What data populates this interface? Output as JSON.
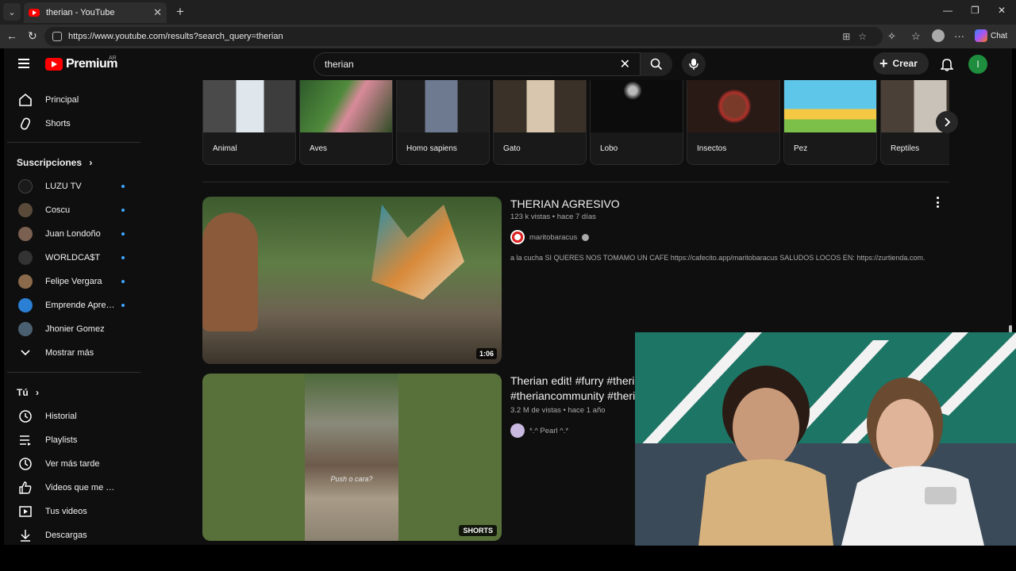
{
  "browser": {
    "tab_title": "therian - YouTube",
    "url": "https://www.youtube.com/results?search_query=therian",
    "copilot_label": "Chat"
  },
  "youtube": {
    "logo_text": "Premium",
    "country_code": "AR",
    "search_query": "therian",
    "create_label": "Crear",
    "user_initial": "I"
  },
  "sidebar": {
    "main": [
      {
        "label": "Principal",
        "icon": "home-icon"
      },
      {
        "label": "Shorts",
        "icon": "shorts-icon"
      }
    ],
    "subscriptions_title": "Suscripciones",
    "subscriptions": [
      {
        "label": "LUZU TV",
        "color": "#1a1a1a"
      },
      {
        "label": "Coscu",
        "color": "#5a4a3a"
      },
      {
        "label": "Juan Londoño",
        "color": "#7a6050"
      },
      {
        "label": "WORLDCA$T",
        "color": "#333333"
      },
      {
        "label": "Felipe Vergara",
        "color": "#8a6a4a"
      },
      {
        "label": "Emprende Apren...",
        "color": "#2b7fd4"
      },
      {
        "label": "Jhonier Gomez",
        "color": "#4a6070"
      }
    ],
    "show_more": "Mostrar más",
    "you_title": "Tú",
    "you_items": [
      {
        "label": "Historial",
        "icon": "history-icon"
      },
      {
        "label": "Playlists",
        "icon": "playlist-icon"
      },
      {
        "label": "Ver más tarde",
        "icon": "clock-icon"
      },
      {
        "label": "Videos que me gus...",
        "icon": "thumbs-up-icon"
      },
      {
        "label": "Tus videos",
        "icon": "your-videos-icon"
      },
      {
        "label": "Descargas",
        "icon": "download-icon"
      }
    ]
  },
  "chips": [
    {
      "label": "Animal"
    },
    {
      "label": "Aves"
    },
    {
      "label": "Homo sapiens"
    },
    {
      "label": "Gato"
    },
    {
      "label": "Lobo"
    },
    {
      "label": "Insectos"
    },
    {
      "label": "Pez"
    },
    {
      "label": "Reptiles"
    }
  ],
  "results": [
    {
      "title": "THERIAN AGRESIVO",
      "meta": "123 k vistas • hace 7 días",
      "channel": "maritobaracus",
      "description": "a la cucha SI QUERES NOS TOMAMO UN CAFE https://cafecito.app/maritobaracus SALUDOS LOCOS EN: https://zurtienda.com.",
      "duration": "1:06"
    },
    {
      "title_line1": "Therian edit! #furry #theria",
      "title_line2": "#theriancommunity #theri",
      "meta": "3.2 M de vistas • hace 1 año",
      "channel": "*.^ Pearl ^.*",
      "badge": "SHORTS",
      "overlay_text": "Push o cara?"
    }
  ]
}
